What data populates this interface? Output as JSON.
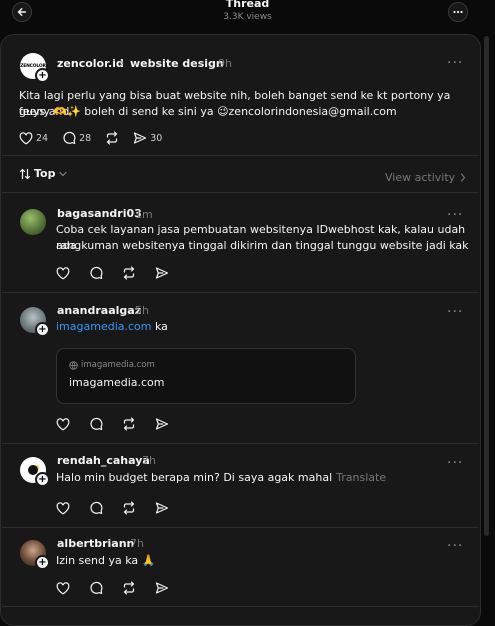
{
  "header": {
    "title": "Thread",
    "views": "3.3K views"
  },
  "main_post": {
    "avatar_text": "ZENCOLOR",
    "username": "zencolor.id",
    "topic": "website design",
    "time": "9h",
    "text_line1": "Kita lagi perlu yang bisa buat website nih, boleh banget send ke kt portony ya guys and",
    "text_line2": "feeny 🫶✨ boleh di send ke sini ya 😉zencolorindonesia@gmail.com",
    "likes": "24",
    "replies": "28",
    "shares": "30"
  },
  "sort": {
    "label": "Top",
    "view_activity": "View activity"
  },
  "replies": [
    {
      "username": "bagasandri03",
      "time": "1m",
      "line1": "Coba cek layanan jasa pembuatan websitenya IDwebhost kak, kalau udah ada",
      "line2": "rangkuman websitenya tinggal dikirim dan tinggal tunggu website jadi kak"
    },
    {
      "username": "anandraalgaz",
      "time": "5h",
      "link_text": "imagamedia.com",
      "after_link": " ka",
      "card_domain": "imagamedia.com",
      "card_title": "imagamedia.com"
    },
    {
      "username": "rendah_cahaya",
      "time": "7h",
      "text": "Halo min budget berapa min? Di saya agak mahal",
      "translate": "Translate"
    },
    {
      "username": "albertbriann",
      "time": "7h",
      "text": "Izin send ya ka 🙏"
    }
  ],
  "colors": {
    "background": "#0a0a0a",
    "panel": "#181818",
    "link": "#3b96f6",
    "text": "#f3f5f7",
    "muted": "#777777"
  }
}
